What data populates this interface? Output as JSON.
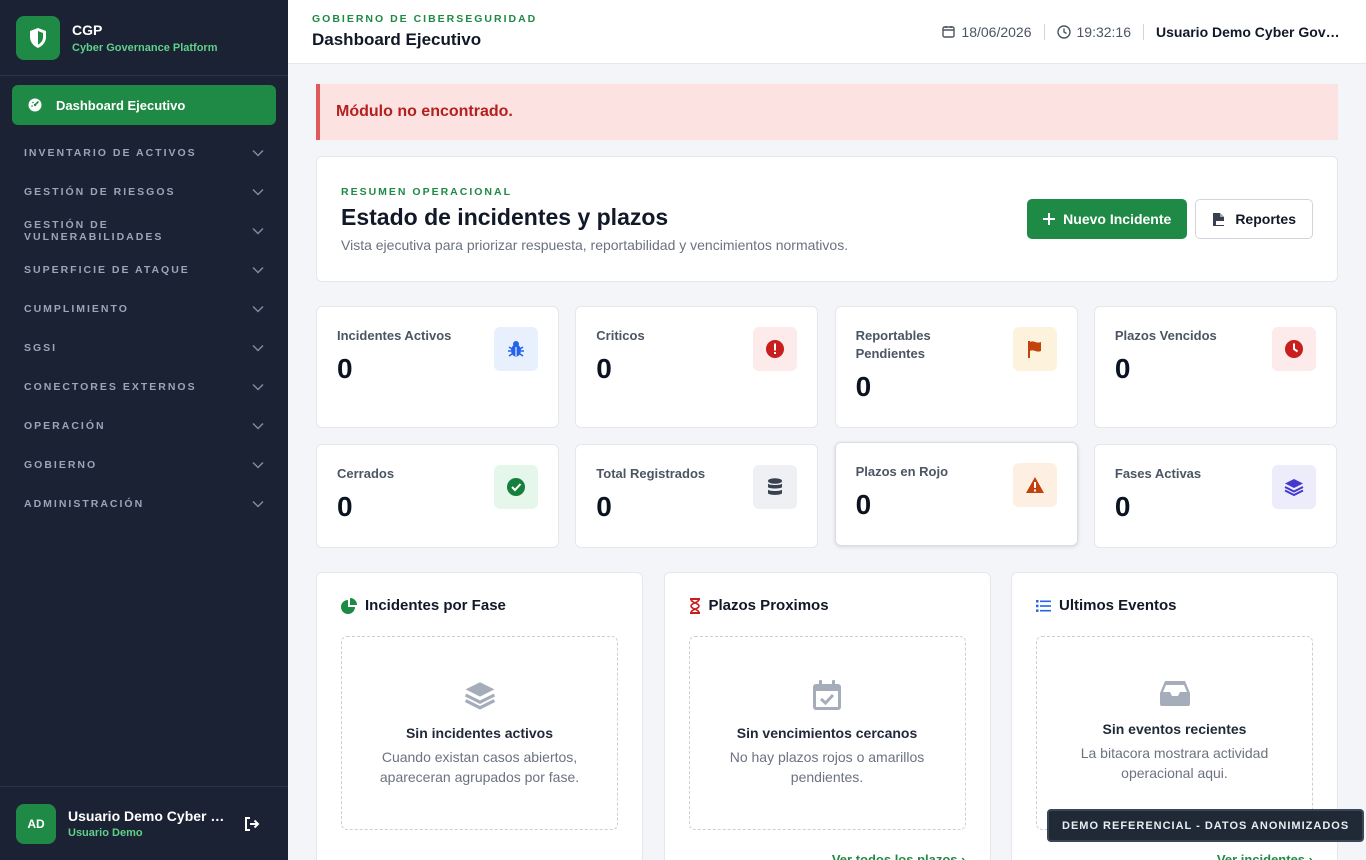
{
  "sidebar": {
    "brand_title": "CGP",
    "brand_subtitle": "Cyber Governance Platform",
    "active_item": "Dashboard Ejecutivo",
    "groups": [
      "INVENTARIO DE ACTIVOS",
      "GESTIÓN DE RIESGOS",
      "GESTIÓN DE VULNERABILIDADES",
      "SUPERFICIE DE ATAQUE",
      "CUMPLIMIENTO",
      "SGSI",
      "CONECTORES EXTERNOS",
      "OPERACIÓN",
      "GOBIERNO",
      "ADMINISTRACIÓN"
    ],
    "user_initials": "AD",
    "user_name": "Usuario Demo Cyber Governance",
    "user_role": "Usuario Demo"
  },
  "header": {
    "kicker": "GOBIERNO DE CIBERSEGURIDAD",
    "title": "Dashboard Ejecutivo",
    "date": "18/06/2026",
    "time": "19:32:16",
    "user": "Usuario Demo Cyber Governance"
  },
  "alert": "Módulo no encontrado.",
  "summary": {
    "kicker": "RESUMEN OPERACIONAL",
    "title": "Estado de incidentes y plazos",
    "description": "Vista ejecutiva para priorizar respuesta, reportabilidad y vencimientos normativos.",
    "new_button": "Nuevo Incidente",
    "reports_button": "Reportes"
  },
  "stats": [
    {
      "label": "Incidentes Activos",
      "value": "0",
      "icon": "bug-icon"
    },
    {
      "label": "Criticos",
      "value": "0",
      "icon": "alert-circle-icon"
    },
    {
      "label": "Reportables Pendientes",
      "value": "0",
      "icon": "flag-icon"
    },
    {
      "label": "Plazos Vencidos",
      "value": "0",
      "icon": "clock-icon"
    },
    {
      "label": "Cerrados",
      "value": "0",
      "icon": "check-circle-icon"
    },
    {
      "label": "Total Registrados",
      "value": "0",
      "icon": "database-icon"
    },
    {
      "label": "Plazos en Rojo",
      "value": "0",
      "icon": "warning-triangle-icon"
    },
    {
      "label": "Fases Activas",
      "value": "0",
      "icon": "layers-icon"
    }
  ],
  "panels": [
    {
      "title": "Incidentes por Fase",
      "empty_title": "Sin incidentes activos",
      "empty_desc": "Cuando existan casos abiertos, apareceran agrupados por fase.",
      "link": ""
    },
    {
      "title": "Plazos Proximos",
      "empty_title": "Sin vencimientos cercanos",
      "empty_desc": "No hay plazos rojos o amarillos pendientes.",
      "link": "Ver todos los plazos"
    },
    {
      "title": "Ultimos Eventos",
      "empty_title": "Sin eventos recientes",
      "empty_desc": "La bitacora mostrara actividad operacional aqui.",
      "link": "Ver incidentes"
    }
  ],
  "demo_badge": "DEMO REFERENCIAL - DATOS ANONIMIZADOS",
  "colors": {
    "sidebar_bg": "#1a2233",
    "accent_green": "#1e8a45",
    "alert_bg": "#fde2e2",
    "alert_text": "#b3201f"
  }
}
